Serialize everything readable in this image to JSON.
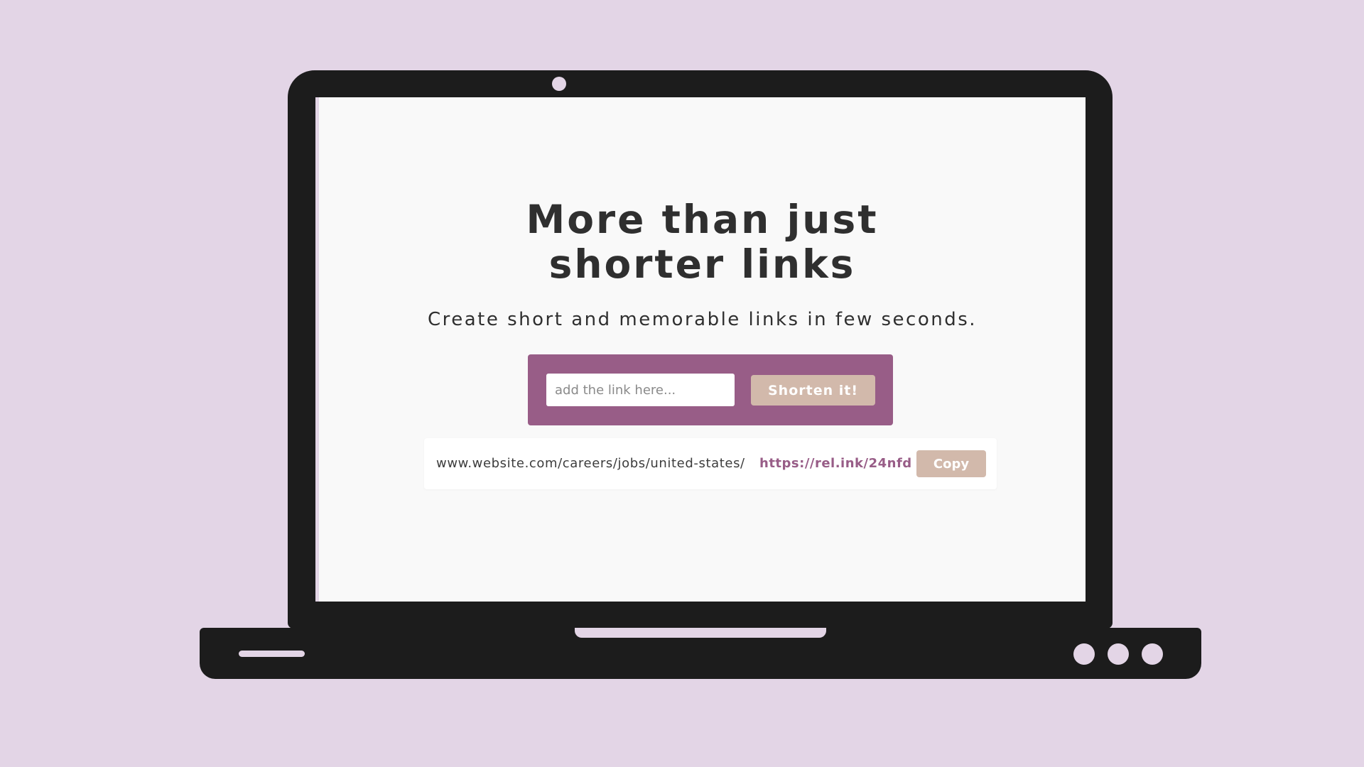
{
  "colors": {
    "background": "#e3d5e6",
    "device": "#1c1c1c",
    "screen": "#f9f9f9",
    "accent": "#985d87",
    "button": "#d2b9ab",
    "text": "#2f2f2f"
  },
  "hero": {
    "headline_line1": "More than just",
    "headline_line2": "shorter links",
    "subtitle": "Create short and memorable links in few seconds."
  },
  "shortener": {
    "input_value": "",
    "input_placeholder": "add the link here...",
    "button_label": "Shorten it!"
  },
  "result": {
    "original_url": "www.website.com/careers/jobs/united-states/",
    "short_url": "https://rel.ink/24nfd",
    "copy_label": "Copy"
  },
  "device": {
    "indicator_lights": 3,
    "webcam_icon": "webcam-icon"
  }
}
